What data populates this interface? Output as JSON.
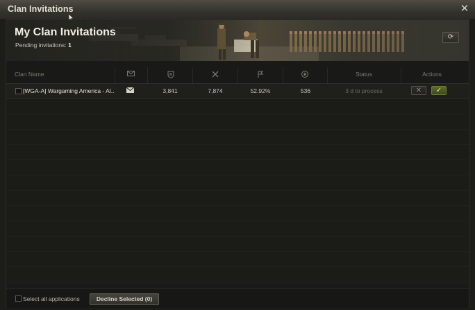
{
  "window": {
    "title": "Clan Invitations",
    "close_glyph": "✕"
  },
  "header": {
    "heading": "My Clan Invitations",
    "pending_label": "Pending invitations:",
    "pending_count": "1",
    "refresh_glyph": "⟳"
  },
  "table": {
    "columns": {
      "clan_name": "Clan Name",
      "invite_icon": "envelope-icon",
      "rating_icon": "shield-icon",
      "battles_icon": "crossed-swords-icon",
      "wins_icon": "flag-icon",
      "wn_icon": "star-badge-icon",
      "status": "Status",
      "actions": "Actions"
    },
    "rows": [
      {
        "clan": "[WGA-A] Wargaming America - Al..",
        "rating": "3,841",
        "battles": "7,874",
        "wins": "52.92%",
        "wn": "536",
        "status": "3 d to process",
        "decline_glyph": "✕",
        "accept_glyph": "✓"
      }
    ]
  },
  "footer": {
    "select_all_label": "Select all applications",
    "decline_selected_label": "Decline Selected (0)"
  },
  "colors": {
    "accent_accept": "#5c6a2c",
    "panel_bg": "#191917"
  }
}
